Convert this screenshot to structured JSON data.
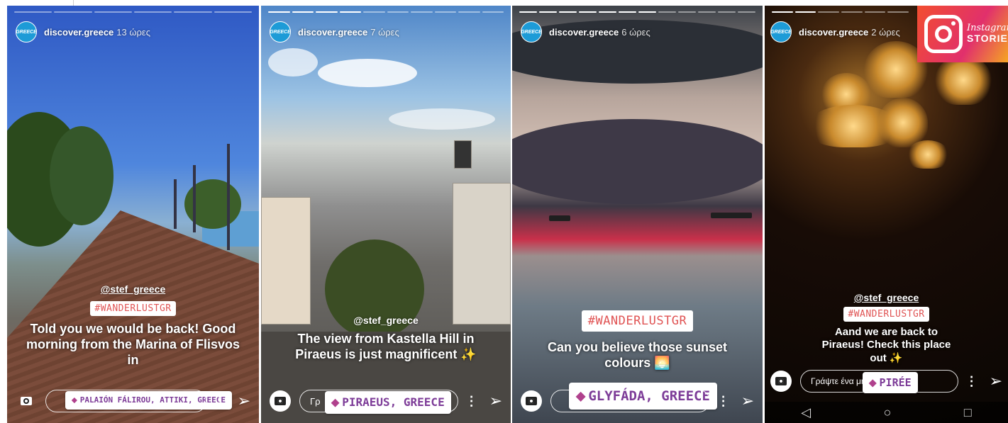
{
  "stories": [
    {
      "user": "discover.greece",
      "avatar_text": "GREECE",
      "time": "13 ώρες",
      "progress_segments": 6,
      "progress_done": 0,
      "mention": "@stef_greece",
      "hashtag": "#WANDERLUSTGR",
      "caption": "Told you we would be back! Good morning from the Marina of Flisvos in",
      "location": "PALAIÓN FÁLIROU, ATTIKI, GREECE",
      "reply_placeholder": "",
      "more": "⋮"
    },
    {
      "user": "discover.greece",
      "avatar_text": "GREECE",
      "time": "7 ώρες",
      "progress_segments": 10,
      "progress_done": 4,
      "mention": "@stef_greece",
      "caption": "The view from Kastella Hill in Piraeus is just magnificent ✨",
      "location": "PIRAEUS, GREECE",
      "reply_placeholder": "Γρ",
      "more": "⋮"
    },
    {
      "user": "discover.greece",
      "avatar_text": "GREECE",
      "time": "6 ώρες",
      "progress_segments": 12,
      "progress_done": 7,
      "hashtag": "#WANDERLUSTGR",
      "caption": "Can you believe those sunset colours 🌅",
      "location": "GLYFÁDA, GREECE",
      "reply_placeholder": "",
      "more": "⋮"
    },
    {
      "user": "discover.greece",
      "avatar_text": "GREECE",
      "time": "2 ώρες",
      "progress_segments": 6,
      "progress_done": 2,
      "mention": "@stef_greece",
      "hashtag": "#WANDERLUSTGR",
      "caption": "Aand we are back to Piraeus! Check this place out ✨",
      "location": "PIRÉE",
      "reply_placeholder": "Γράψτε ένα μήνυμα",
      "more": "⋮",
      "nav": {
        "back": "◁",
        "home": "○",
        "recent": "□"
      }
    }
  ],
  "badge": {
    "line1": "Instagram",
    "line2": "STORIES"
  },
  "icons": {
    "camera": "camera-icon",
    "send": "send-icon",
    "pin": "location-pin-icon",
    "more": "more-options-icon"
  },
  "colors": {
    "hashtag_text": "#e05454",
    "location_text": "#7d3c98",
    "avatar_bg": "#1d9bd7",
    "badge_bg": "#e1306c"
  }
}
